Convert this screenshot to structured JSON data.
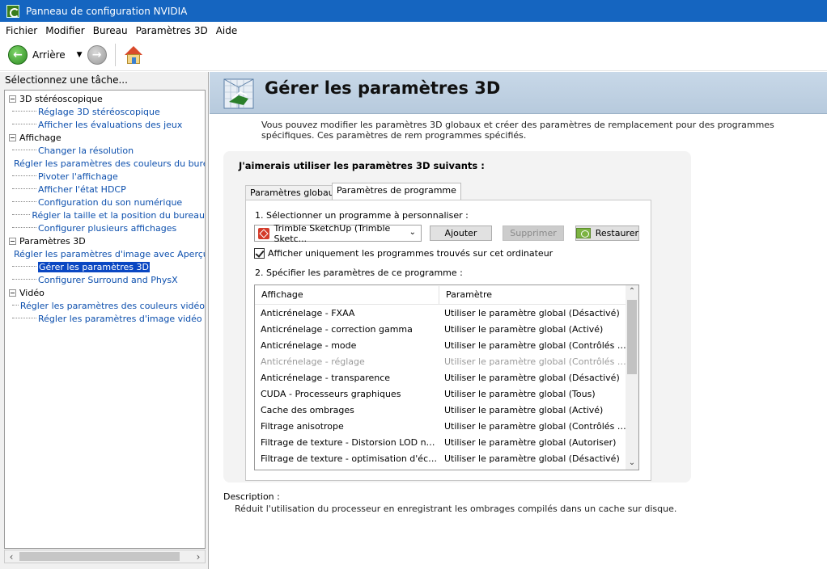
{
  "window": {
    "title": "Panneau de configuration NVIDIA"
  },
  "menu": [
    "Fichier",
    "Modifier",
    "Bureau",
    "Paramètres 3D",
    "Aide"
  ],
  "toolbar": {
    "back_label": "Arrière"
  },
  "left_pane": {
    "header": "Sélectionnez une tâche...",
    "tree": [
      {
        "label": "3D stéréoscopique",
        "children": [
          "Réglage 3D stéréoscopique",
          "Afficher les évaluations des jeux"
        ]
      },
      {
        "label": "Affichage",
        "children": [
          "Changer la résolution",
          "Régler les paramètres des couleurs du bureau",
          "Pivoter l'affichage",
          "Afficher l'état HDCP",
          "Configuration du son numérique",
          "Régler la taille et la position du bureau",
          "Configurer plusieurs affichages"
        ]
      },
      {
        "label": "Paramètres 3D",
        "children": [
          "Régler les paramètres d'image avec Aperçu",
          "Gérer les paramètres 3D",
          "Configurer Surround and PhysX"
        ]
      },
      {
        "label": "Vidéo",
        "children": [
          "Régler les paramètres des couleurs vidéo",
          "Régler les paramètres d'image vidéo"
        ]
      }
    ],
    "selected": "Gérer les paramètres 3D"
  },
  "main": {
    "title": "Gérer les paramètres 3D",
    "intro": "Vous pouvez modifier les paramètres 3D globaux et créer des paramètres de remplacement pour des programmes spécifiques. Ces paramètres de rem programmes spécifiés.",
    "settings_heading": "J'aimerais utiliser les paramètres 3D suivants :",
    "tabs": [
      {
        "label": "Paramètres globaux",
        "active": false
      },
      {
        "label": "Paramètres de programme",
        "active": true
      }
    ],
    "step1": "1. Sélectionner un programme à personnaliser :",
    "program_select": "Trimble SketchUp (Trimble Sketc...",
    "buttons": {
      "add": "Ajouter",
      "remove": "Supprimer",
      "restore": "Restaurer"
    },
    "checkbox_label": "Afficher uniquement les programmes trouvés sur cet ordinateur",
    "checkbox_checked": true,
    "step2": "2. Spécifier les paramètres de ce programme :",
    "table": {
      "columns": [
        "Affichage",
        "Paramètre"
      ],
      "rows": [
        {
          "feature": "Anticrénelage - FXAA",
          "setting": "Utiliser le paramètre global (Désactivé)",
          "disabled": false
        },
        {
          "feature": "Anticrénelage - correction gamma",
          "setting": "Utiliser le paramètre global (Activé)",
          "disabled": false
        },
        {
          "feature": "Anticrénelage - mode",
          "setting": "Utiliser le paramètre global (Contrôlés par l...",
          "disabled": false
        },
        {
          "feature": "Anticrénelage - réglage",
          "setting": "Utiliser le paramètre global (Contrôlés par l...",
          "disabled": true
        },
        {
          "feature": "Anticrénelage - transparence",
          "setting": "Utiliser le paramètre global (Désactivé)",
          "disabled": false
        },
        {
          "feature": "CUDA - Processeurs graphiques",
          "setting": "Utiliser le paramètre global (Tous)",
          "disabled": false
        },
        {
          "feature": "Cache des ombrages",
          "setting": "Utiliser le paramètre global (Activé)",
          "disabled": false
        },
        {
          "feature": "Filtrage anisotrope",
          "setting": "Utiliser le paramètre global (Contrôlés par l...",
          "disabled": false
        },
        {
          "feature": "Filtrage de texture - Distorsion LOD négative",
          "setting": "Utiliser le paramètre global (Autoriser)",
          "disabled": false
        },
        {
          "feature": "Filtrage de texture - optimisation d'échanti...",
          "setting": "Utiliser le paramètre global (Désactivé)",
          "disabled": false
        }
      ]
    },
    "description_label": "Description :",
    "description_text": "Réduit l'utilisation du processeur en enregistrant les ombrages compilés dans un cache sur disque."
  }
}
